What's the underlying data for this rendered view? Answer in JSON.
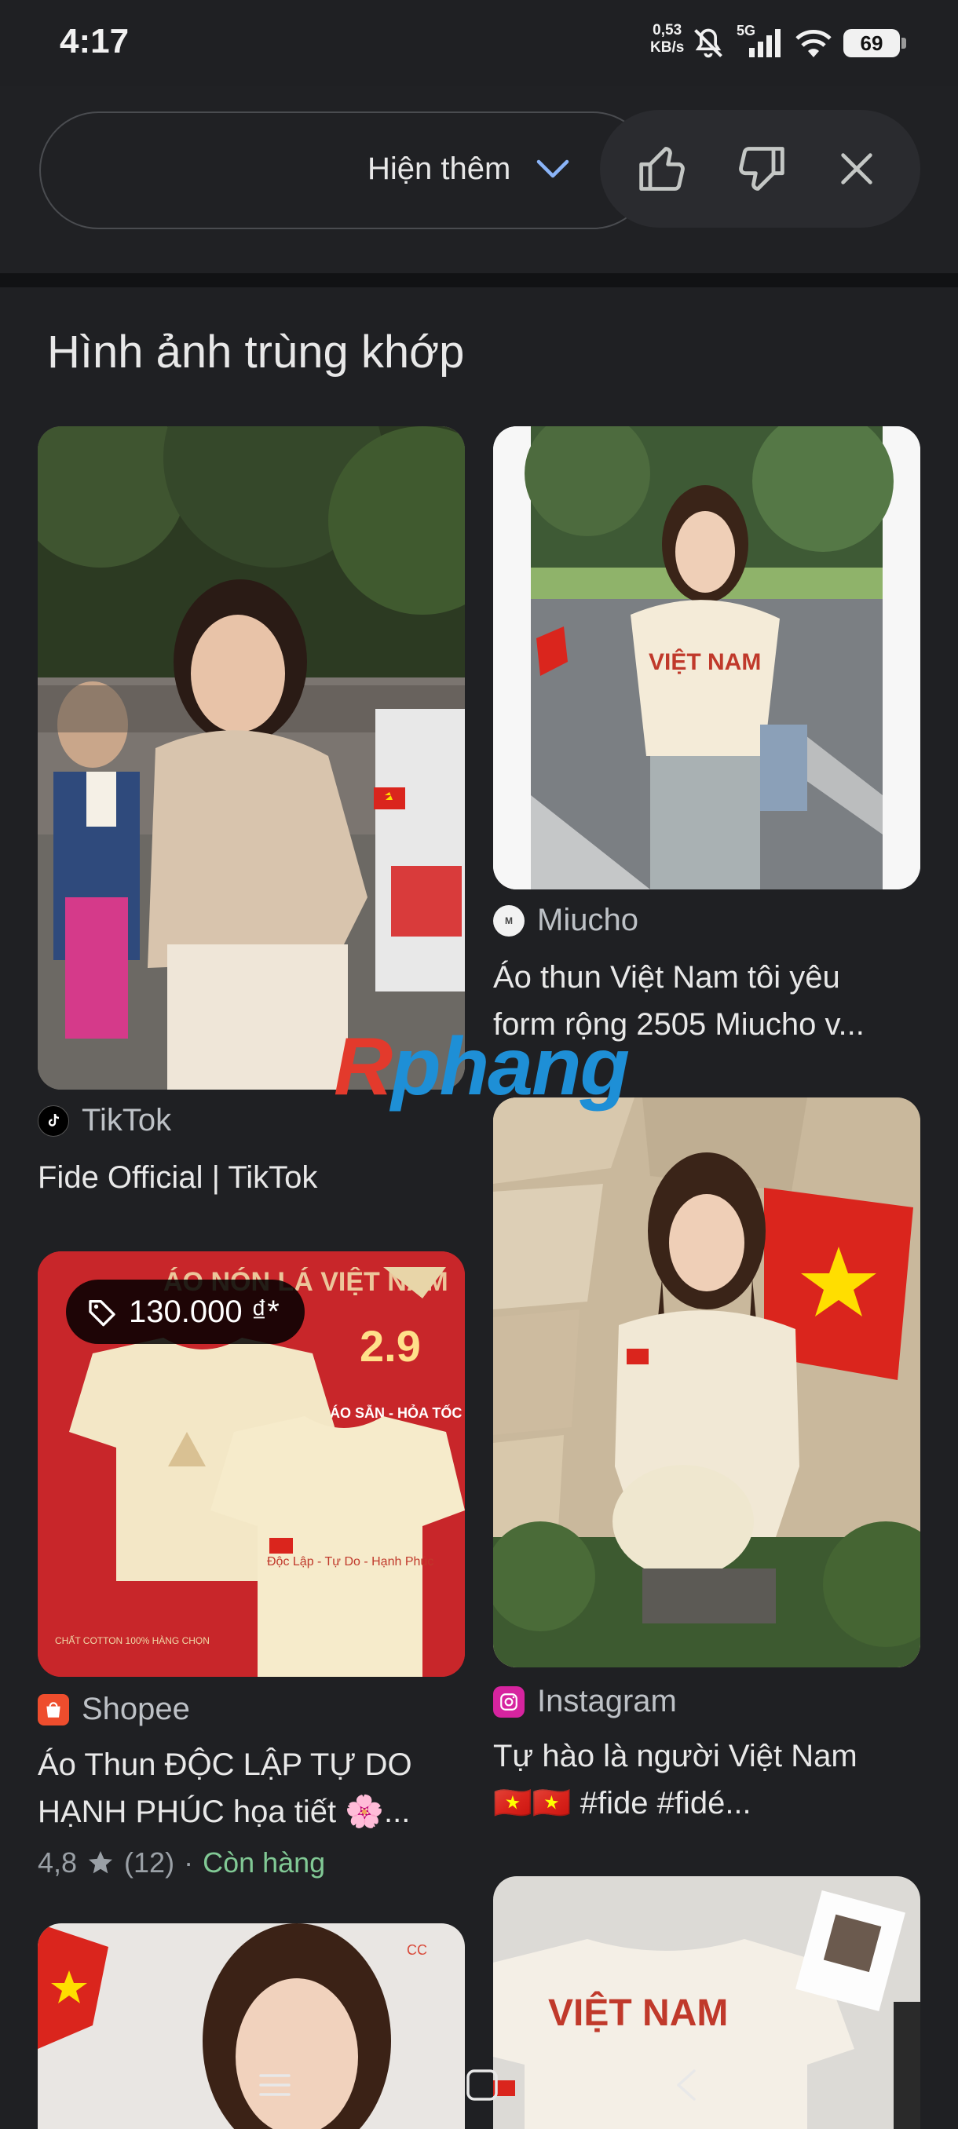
{
  "status_bar": {
    "time": "4:17",
    "net_speed_value": "0,53",
    "net_speed_unit": "KB/s",
    "network": "5G",
    "battery": "69"
  },
  "top_bar": {
    "show_more_label": "Hiện thêm",
    "icons": [
      "thumbs-up-icon",
      "thumbs-down-icon",
      "close-icon"
    ]
  },
  "section": {
    "title": "Hình ảnh trùng khớp"
  },
  "results": [
    {
      "source": "TikTok",
      "title": "Fide Official | TikTok"
    },
    {
      "source": "Miucho",
      "title_line1": "Áo thun Việt Nam tôi yêu",
      "title_line2": "form rộng 2505 Miucho v..."
    },
    {
      "source": "Shopee",
      "price": "130.000 ₫*",
      "title_line1": "Áo Thun ĐỘC LẬP TỰ DO",
      "title_line2": "HẠNH PHÚC họa tiết 🌸...",
      "rating": "4,8",
      "reviews": "(12)",
      "separator": "·",
      "stock": "Còn hàng"
    },
    {
      "source": "Instagram",
      "title_line1": "Tự hào là người Việt Nam",
      "title_line2": "🇻🇳🇻🇳 #fide #fidé..."
    }
  ],
  "watermark": {
    "part1": "R",
    "part2": "phang"
  },
  "colors": {
    "background": "#1f2023",
    "text": "#e8e8e8",
    "muted": "#bdc1c6",
    "in_stock": "#81c995",
    "flag_red": "#da251d",
    "flag_yellow": "#ffde00"
  }
}
